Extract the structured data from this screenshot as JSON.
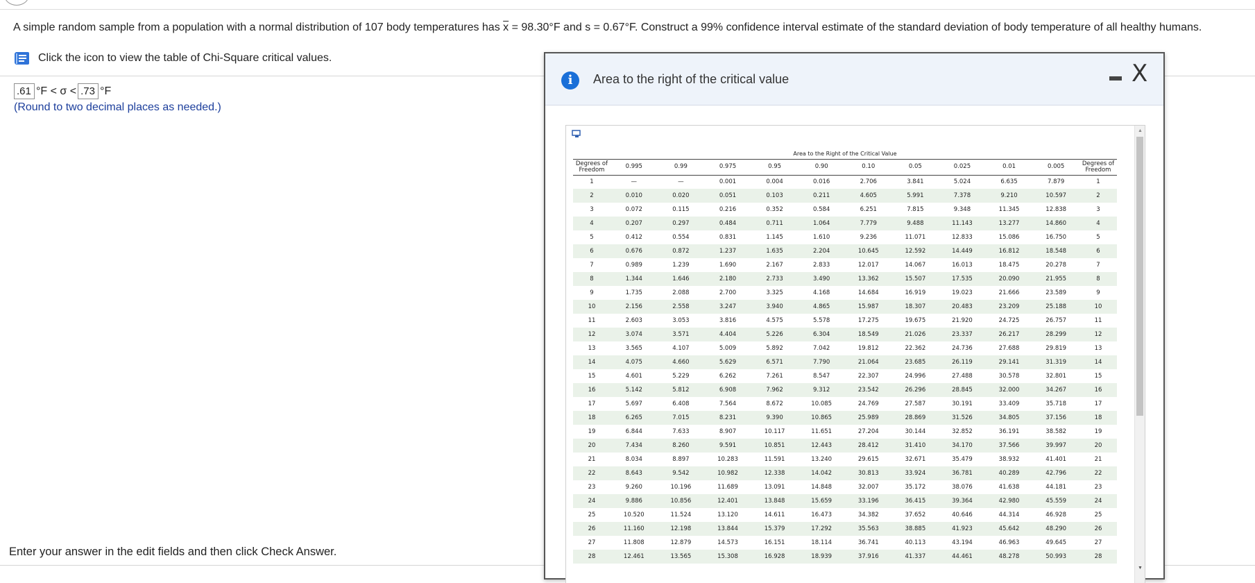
{
  "question": {
    "part1": "A simple random sample from a population with a normal distribution of 107 body temperatures has ",
    "xbar_symbol": "x",
    "part2": " = 98.30°F and s = 0.67°F. Construct a 99% confidence interval estimate of the standard deviation of body temperature of all healthy humans."
  },
  "table_link": {
    "icon": "book-icon",
    "text": "Click the icon to view the table of Chi-Square critical values."
  },
  "answer": {
    "lower_value": ".61",
    "upper_value": ".73",
    "unit_lower": "°F < σ <",
    "unit_upper": "°F",
    "hint": "(Round to two decimal places as needed.)"
  },
  "footer_text": "Enter your answer in the edit fields and then click Check Answer.",
  "popup": {
    "title": "Area to the right of the critical value",
    "icon": "info-icon",
    "minimize_icon": "minimize-icon",
    "close_icon": "close-icon",
    "close_glyph": "X"
  },
  "chi_table": {
    "caption": "Area to the Right of the Critical Value",
    "df_header_line1": "Degrees of",
    "df_header_line2": "Freedom",
    "alphas": [
      "0.995",
      "0.99",
      "0.975",
      "0.95",
      "0.90",
      "0.10",
      "0.05",
      "0.025",
      "0.01",
      "0.005"
    ],
    "rows": [
      [
        "1",
        "—",
        "—",
        "0.001",
        "0.004",
        "0.016",
        "2.706",
        "3.841",
        "5.024",
        "6.635",
        "7.879",
        "1"
      ],
      [
        "2",
        "0.010",
        "0.020",
        "0.051",
        "0.103",
        "0.211",
        "4.605",
        "5.991",
        "7.378",
        "9.210",
        "10.597",
        "2"
      ],
      [
        "3",
        "0.072",
        "0.115",
        "0.216",
        "0.352",
        "0.584",
        "6.251",
        "7.815",
        "9.348",
        "11.345",
        "12.838",
        "3"
      ],
      [
        "4",
        "0.207",
        "0.297",
        "0.484",
        "0.711",
        "1.064",
        "7.779",
        "9.488",
        "11.143",
        "13.277",
        "14.860",
        "4"
      ],
      [
        "5",
        "0.412",
        "0.554",
        "0.831",
        "1.145",
        "1.610",
        "9.236",
        "11.071",
        "12.833",
        "15.086",
        "16.750",
        "5"
      ],
      [
        "6",
        "0.676",
        "0.872",
        "1.237",
        "1.635",
        "2.204",
        "10.645",
        "12.592",
        "14.449",
        "16.812",
        "18.548",
        "6"
      ],
      [
        "7",
        "0.989",
        "1.239",
        "1.690",
        "2.167",
        "2.833",
        "12.017",
        "14.067",
        "16.013",
        "18.475",
        "20.278",
        "7"
      ],
      [
        "8",
        "1.344",
        "1.646",
        "2.180",
        "2.733",
        "3.490",
        "13.362",
        "15.507",
        "17.535",
        "20.090",
        "21.955",
        "8"
      ],
      [
        "9",
        "1.735",
        "2.088",
        "2.700",
        "3.325",
        "4.168",
        "14.684",
        "16.919",
        "19.023",
        "21.666",
        "23.589",
        "9"
      ],
      [
        "10",
        "2.156",
        "2.558",
        "3.247",
        "3.940",
        "4.865",
        "15.987",
        "18.307",
        "20.483",
        "23.209",
        "25.188",
        "10"
      ],
      [
        "11",
        "2.603",
        "3.053",
        "3.816",
        "4.575",
        "5.578",
        "17.275",
        "19.675",
        "21.920",
        "24.725",
        "26.757",
        "11"
      ],
      [
        "12",
        "3.074",
        "3.571",
        "4.404",
        "5.226",
        "6.304",
        "18.549",
        "21.026",
        "23.337",
        "26.217",
        "28.299",
        "12"
      ],
      [
        "13",
        "3.565",
        "4.107",
        "5.009",
        "5.892",
        "7.042",
        "19.812",
        "22.362",
        "24.736",
        "27.688",
        "29.819",
        "13"
      ],
      [
        "14",
        "4.075",
        "4.660",
        "5.629",
        "6.571",
        "7.790",
        "21.064",
        "23.685",
        "26.119",
        "29.141",
        "31.319",
        "14"
      ],
      [
        "15",
        "4.601",
        "5.229",
        "6.262",
        "7.261",
        "8.547",
        "22.307",
        "24.996",
        "27.488",
        "30.578",
        "32.801",
        "15"
      ],
      [
        "16",
        "5.142",
        "5.812",
        "6.908",
        "7.962",
        "9.312",
        "23.542",
        "26.296",
        "28.845",
        "32.000",
        "34.267",
        "16"
      ],
      [
        "17",
        "5.697",
        "6.408",
        "7.564",
        "8.672",
        "10.085",
        "24.769",
        "27.587",
        "30.191",
        "33.409",
        "35.718",
        "17"
      ],
      [
        "18",
        "6.265",
        "7.015",
        "8.231",
        "9.390",
        "10.865",
        "25.989",
        "28.869",
        "31.526",
        "34.805",
        "37.156",
        "18"
      ],
      [
        "19",
        "6.844",
        "7.633",
        "8.907",
        "10.117",
        "11.651",
        "27.204",
        "30.144",
        "32.852",
        "36.191",
        "38.582",
        "19"
      ],
      [
        "20",
        "7.434",
        "8.260",
        "9.591",
        "10.851",
        "12.443",
        "28.412",
        "31.410",
        "34.170",
        "37.566",
        "39.997",
        "20"
      ],
      [
        "21",
        "8.034",
        "8.897",
        "10.283",
        "11.591",
        "13.240",
        "29.615",
        "32.671",
        "35.479",
        "38.932",
        "41.401",
        "21"
      ],
      [
        "22",
        "8.643",
        "9.542",
        "10.982",
        "12.338",
        "14.042",
        "30.813",
        "33.924",
        "36.781",
        "40.289",
        "42.796",
        "22"
      ],
      [
        "23",
        "9.260",
        "10.196",
        "11.689",
        "13.091",
        "14.848",
        "32.007",
        "35.172",
        "38.076",
        "41.638",
        "44.181",
        "23"
      ],
      [
        "24",
        "9.886",
        "10.856",
        "12.401",
        "13.848",
        "15.659",
        "33.196",
        "36.415",
        "39.364",
        "42.980",
        "45.559",
        "24"
      ],
      [
        "25",
        "10.520",
        "11.524",
        "13.120",
        "14.611",
        "16.473",
        "34.382",
        "37.652",
        "40.646",
        "44.314",
        "46.928",
        "25"
      ],
      [
        "26",
        "11.160",
        "12.198",
        "13.844",
        "15.379",
        "17.292",
        "35.563",
        "38.885",
        "41.923",
        "45.642",
        "48.290",
        "26"
      ],
      [
        "27",
        "11.808",
        "12.879",
        "14.573",
        "16.151",
        "18.114",
        "36.741",
        "40.113",
        "43.194",
        "46.963",
        "49.645",
        "27"
      ],
      [
        "28",
        "12.461",
        "13.565",
        "15.308",
        "16.928",
        "18.939",
        "37.916",
        "41.337",
        "44.461",
        "48.278",
        "50.993",
        "28"
      ]
    ]
  }
}
